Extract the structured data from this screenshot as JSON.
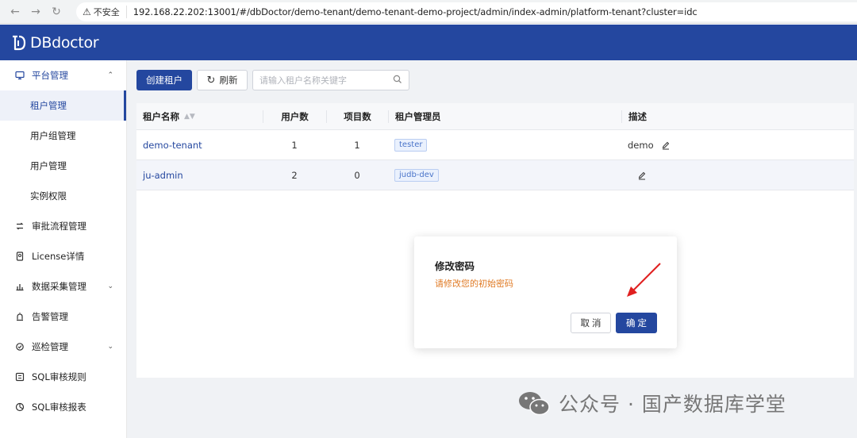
{
  "browser": {
    "insecure_label": "不安全",
    "url": "192.168.22.202:13001/#/dbDoctor/demo-tenant/demo-tenant-demo-project/admin/index-admin/platform-tenant?cluster=idc"
  },
  "app": {
    "logo_text": "DBdoctor",
    "brand_color": "#24479f"
  },
  "sidebar": {
    "items": [
      {
        "label": "平台管理",
        "icon": "monitor-icon",
        "expanded": true
      },
      {
        "label": "租户管理",
        "selected": true
      },
      {
        "label": "用户组管理"
      },
      {
        "label": "用户管理"
      },
      {
        "label": "实例权限"
      },
      {
        "label": "审批流程管理",
        "icon": "flow-icon"
      },
      {
        "label": "License详情",
        "icon": "license-icon"
      },
      {
        "label": "数据采集管理",
        "icon": "collect-icon",
        "expandable": true
      },
      {
        "label": "告警管理",
        "icon": "alarm-icon"
      },
      {
        "label": "巡检管理",
        "icon": "inspect-icon",
        "expandable": true
      },
      {
        "label": "SQL审核规则",
        "icon": "rule-icon"
      },
      {
        "label": "SQL审核报表",
        "icon": "report-icon"
      }
    ]
  },
  "toolbar": {
    "create_label": "创建租户",
    "refresh_label": "刷新",
    "search_placeholder": "请输入租户名称关键字"
  },
  "table": {
    "headers": [
      "租户名称",
      "用户数",
      "项目数",
      "租户管理员",
      "描述"
    ],
    "rows": [
      {
        "name": "demo-tenant",
        "users": "1",
        "projects": "1",
        "admin": "tester",
        "desc": "demo"
      },
      {
        "name": "ju-admin",
        "users": "2",
        "projects": "0",
        "admin": "judb-dev",
        "desc": ""
      }
    ]
  },
  "dialog": {
    "title": "修改密码",
    "message": "请修改您的初始密码",
    "cancel_label": "取消",
    "ok_label": "确定",
    "message_color": "#e07b26"
  },
  "watermark": {
    "text": "公众号 · 国产数据库学堂"
  }
}
